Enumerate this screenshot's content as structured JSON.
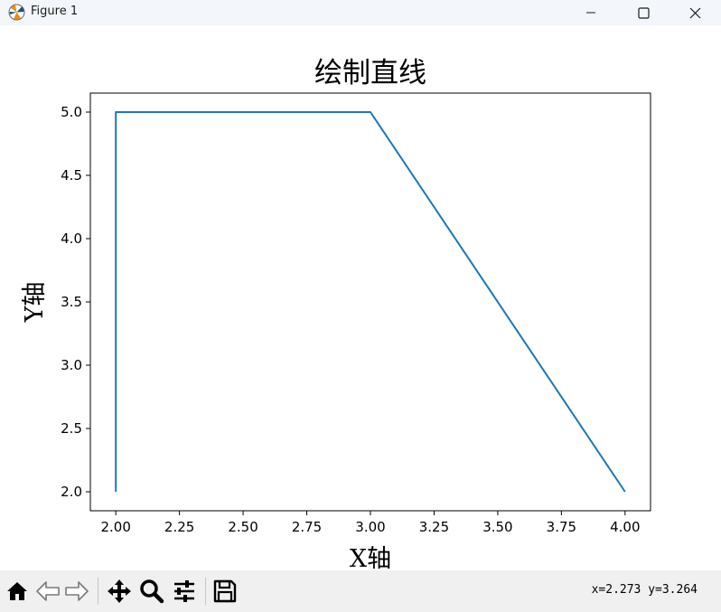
{
  "window": {
    "title": "Figure 1"
  },
  "toolbar": {
    "buttons": [
      "home-icon",
      "back-icon",
      "forward-icon",
      "pan-icon",
      "zoom-icon",
      "configure-subplots-icon",
      "save-icon"
    ],
    "coords_readout": "x=2.273  y=3.264"
  },
  "chart_data": {
    "type": "line",
    "title": "绘制直线",
    "xlabel": "X轴",
    "ylabel": "Y轴",
    "x": [
      2,
      2,
      3,
      4
    ],
    "series": [
      {
        "values": [
          2,
          5,
          5,
          2
        ],
        "color": "#1f77b4"
      }
    ],
    "xlim": [
      1.9,
      4.1
    ],
    "ylim": [
      1.85,
      5.15
    ],
    "xticks": [
      2.0,
      2.25,
      2.5,
      2.75,
      3.0,
      3.25,
      3.5,
      3.75,
      4.0
    ],
    "xtick_labels": [
      "2.00",
      "2.25",
      "2.50",
      "2.75",
      "3.00",
      "3.25",
      "3.50",
      "3.75",
      "4.00"
    ],
    "yticks": [
      2.0,
      2.5,
      3.0,
      3.5,
      4.0,
      4.5,
      5.0
    ],
    "ytick_labels": [
      "2.0",
      "2.5",
      "3.0",
      "3.5",
      "4.0",
      "4.5",
      "5.0"
    ],
    "grid": false
  }
}
